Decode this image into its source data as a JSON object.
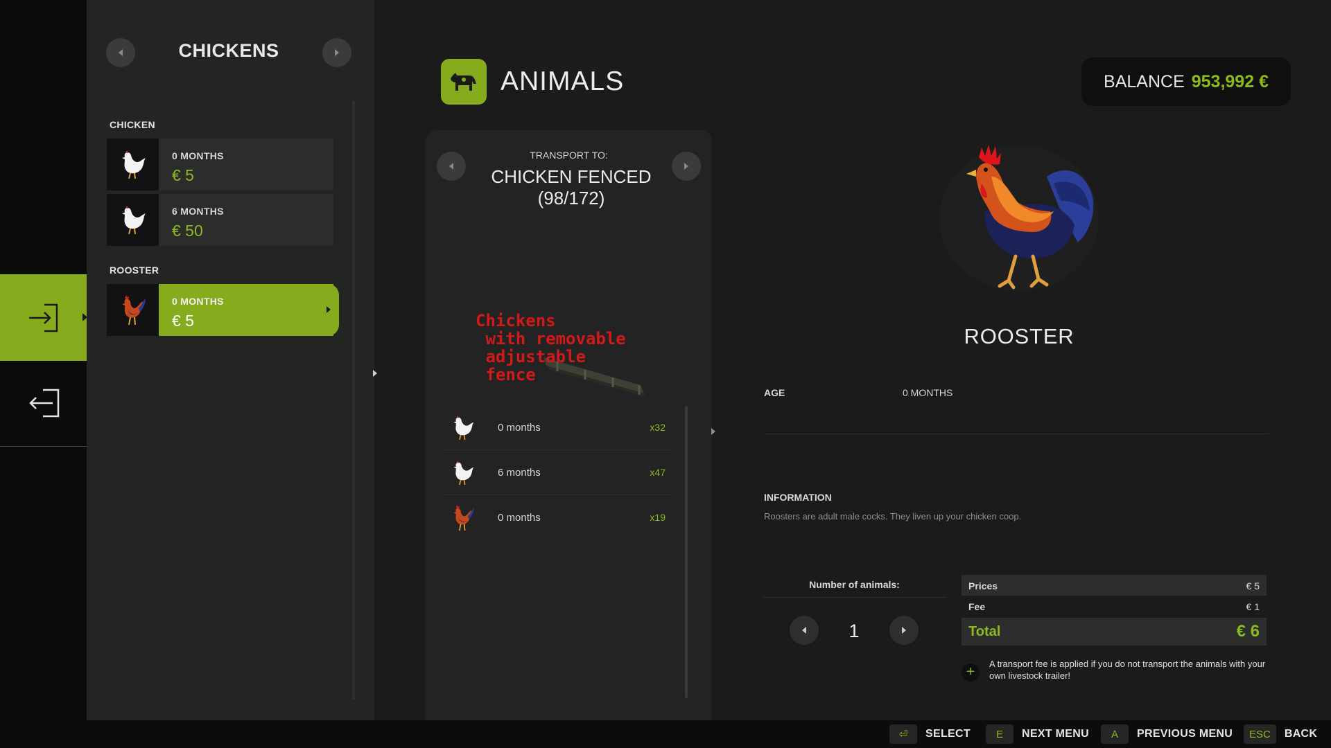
{
  "category": {
    "title": "CHICKENS"
  },
  "groups": [
    {
      "label": "CHICKEN",
      "items": [
        {
          "age": "0 MONTHS",
          "price": "€ 5",
          "icon": "hen-icon"
        },
        {
          "age": "6 MONTHS",
          "price": "€ 50",
          "icon": "hen-icon"
        }
      ]
    },
    {
      "label": "ROOSTER",
      "items": [
        {
          "age": "0 MONTHS",
          "price": "€ 5",
          "icon": "rooster-icon",
          "selected": true
        }
      ]
    }
  ],
  "header": {
    "title": "ANIMALS",
    "balance_label": "BALANCE",
    "balance_value": "953,992 €"
  },
  "transport": {
    "label": "TRANSPORT TO:",
    "destination": "CHICKEN FENCED\n(98/172)",
    "note": "Chickens\n with removable\n adjustable\n fence",
    "herd": [
      {
        "age": "0 months",
        "count": "x32",
        "icon": "hen-icon"
      },
      {
        "age": "6 months",
        "count": "x47",
        "icon": "hen-icon"
      },
      {
        "age": "0 months",
        "count": "x19",
        "icon": "rooster-icon"
      }
    ]
  },
  "detail": {
    "name": "ROOSTER",
    "age_label": "AGE",
    "age_value": "0 MONTHS",
    "info_title": "INFORMATION",
    "info_text": "Roosters are adult male cocks. They liven up your chicken coop."
  },
  "purchase": {
    "quantity_label": "Number of animals:",
    "quantity": "1",
    "prices_label": "Prices",
    "prices_value": "€ 5",
    "fee_label": "Fee",
    "fee_value": "€ 1",
    "total_label": "Total",
    "total_value": "€ 6",
    "fee_note": "A transport fee is applied if you do not transport the animals with your own livestock trailer!"
  },
  "hints": [
    {
      "key": "⏎",
      "action": "SELECT"
    },
    {
      "key": "E",
      "action": "NEXT MENU"
    },
    {
      "key": "A",
      "action": "PREVIOUS MENU"
    },
    {
      "key": "ESC",
      "action": "BACK"
    }
  ],
  "colors": {
    "accent": "#86ab1d",
    "accent_text": "#8bbb1e",
    "annotation": "#d11a1a"
  }
}
